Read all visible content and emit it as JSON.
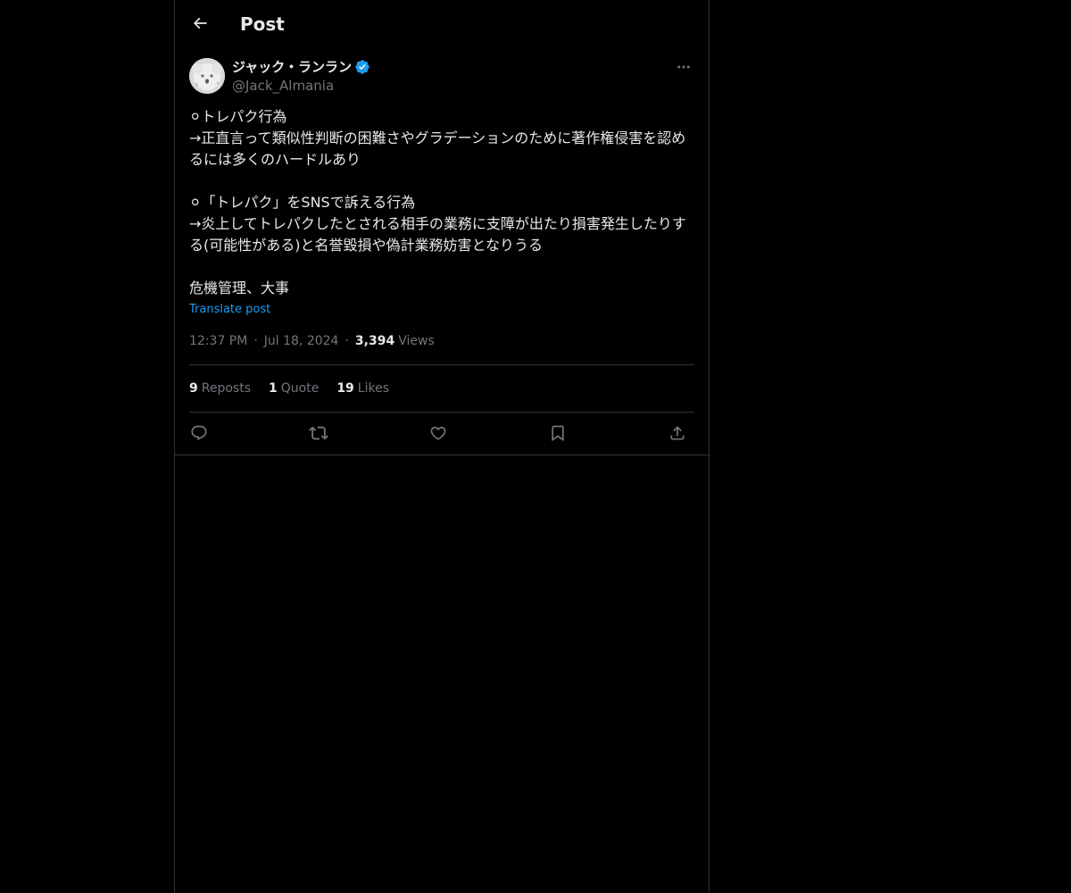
{
  "header": {
    "title": "Post",
    "back_icon": "arrow-left-icon"
  },
  "author": {
    "display_name": "ジャック・ランラン",
    "handle": "@Jack_Almania",
    "verified": true,
    "verified_color": "#1d9bf0"
  },
  "post": {
    "text": "⚪︎トレパク行為\n→正直言って類似性判断の困難さやグラデーションのために著作権侵害を認めるには多くのハードルあり\n\n⚪︎「トレパク」をSNSで訴える行為\n→炎上してトレパクしたとされる相手の業務に支障が出たり損害発生したりする(可能性がある)と名誉毀損や偽計業務妨害となりうる\n\n危機管理、大事",
    "translate_label": "Translate post",
    "time": "12:37 PM",
    "date": "Jul 18, 2024",
    "views_count": "3,394",
    "views_label": "Views"
  },
  "stats": {
    "reposts_count": "9",
    "reposts_label": "Reposts",
    "quotes_count": "1",
    "quotes_label": "Quote",
    "likes_count": "19",
    "likes_label": "Likes"
  },
  "actions": {
    "reply_icon": "reply-icon",
    "repost_icon": "repost-icon",
    "like_icon": "heart-icon",
    "bookmark_icon": "bookmark-icon",
    "share_icon": "share-icon"
  },
  "colors": {
    "background": "#000000",
    "text": "#e7e9ea",
    "secondary": "#71767b",
    "accent": "#1d9bf0",
    "border": "#2f3336"
  }
}
